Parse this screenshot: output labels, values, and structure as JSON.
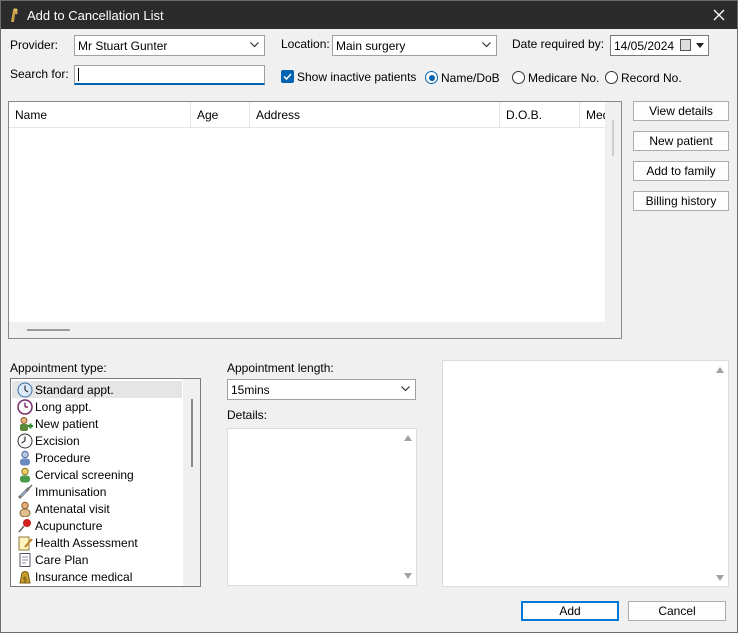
{
  "window": {
    "title": "Add to Cancellation List"
  },
  "filters": {
    "provider_label": "Provider:",
    "provider_value": "Mr Stuart Gunter",
    "location_label": "Location:",
    "location_value": "Main surgery",
    "date_label": "Date required by:",
    "date_value": "14/05/2024",
    "search_label": "Search for:",
    "search_value": "",
    "show_inactive_label": "Show inactive patients",
    "show_inactive_checked": true,
    "search_mode_options": [
      "Name/DoB",
      "Medicare No.",
      "Record No."
    ],
    "search_mode_selected": "Name/DoB"
  },
  "patient_grid": {
    "columns": [
      "Name",
      "Age",
      "Address",
      "D.O.B.",
      "Med"
    ],
    "rows": []
  },
  "side_buttons": {
    "view_details": "View details",
    "new_patient": "New patient",
    "add_to_family": "Add to family",
    "billing_history": "Billing history"
  },
  "appointment": {
    "type_label": "Appointment type:",
    "types": [
      {
        "label": "Standard appt.",
        "icon": "clock-icon",
        "selected": true
      },
      {
        "label": "Long appt.",
        "icon": "long-clock-icon"
      },
      {
        "label": "New patient",
        "icon": "new-patient-icon"
      },
      {
        "label": "Excision",
        "icon": "excision-clock-icon"
      },
      {
        "label": "Procedure",
        "icon": "procedure-person-icon"
      },
      {
        "label": "Cervical screening",
        "icon": "cervical-person-icon"
      },
      {
        "label": "Immunisation",
        "icon": "syringe-icon"
      },
      {
        "label": "Antenatal visit",
        "icon": "antenatal-person-icon"
      },
      {
        "label": "Acupuncture",
        "icon": "pin-icon"
      },
      {
        "label": "Health Assessment",
        "icon": "notepad-pencil-icon"
      },
      {
        "label": "Care Plan",
        "icon": "document-icon"
      },
      {
        "label": "Insurance medical",
        "icon": "money-bag-icon"
      }
    ],
    "length_label": "Appointment length:",
    "length_value": "15mins",
    "details_label": "Details:",
    "details_value": ""
  },
  "actions": {
    "add": "Add",
    "cancel": "Cancel"
  },
  "colors": {
    "accent": "#0063b1",
    "titlebar": "#2b2b2b"
  }
}
